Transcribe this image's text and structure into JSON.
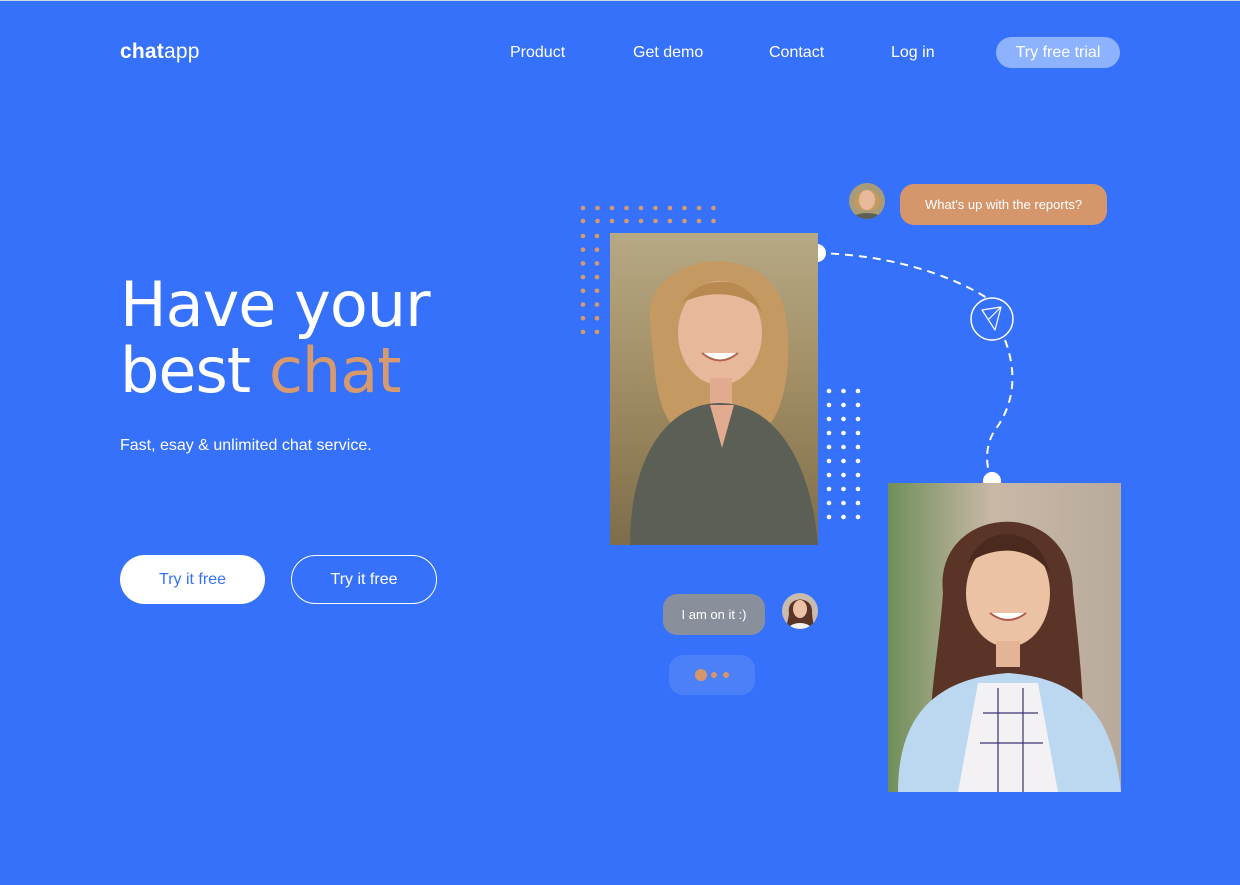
{
  "brand": {
    "bold": "chat",
    "light": "app"
  },
  "nav": {
    "items": [
      "Product",
      "Get demo",
      "Contact",
      "Log in"
    ],
    "cta_label": "Try free trial"
  },
  "hero": {
    "title_line1": "Have your",
    "title_line2_plain": "best",
    "title_line2_accent": "chat",
    "subtitle": "Fast, esay & unlimited chat service.",
    "primary_button": "Try it free",
    "secondary_button": "Try it free"
  },
  "chat": {
    "incoming_message": "What's up with the reports?",
    "outgoing_message": "I am on it :)"
  },
  "icons": {
    "send": "paper-plane-icon",
    "typing": "typing-dots-icon"
  },
  "colors": {
    "background": "#3671fb",
    "accent": "#d89a6c",
    "cta": "#8db2ff",
    "bubble_orange": "#d5966c",
    "bubble_grey": "#8a8f9c"
  }
}
